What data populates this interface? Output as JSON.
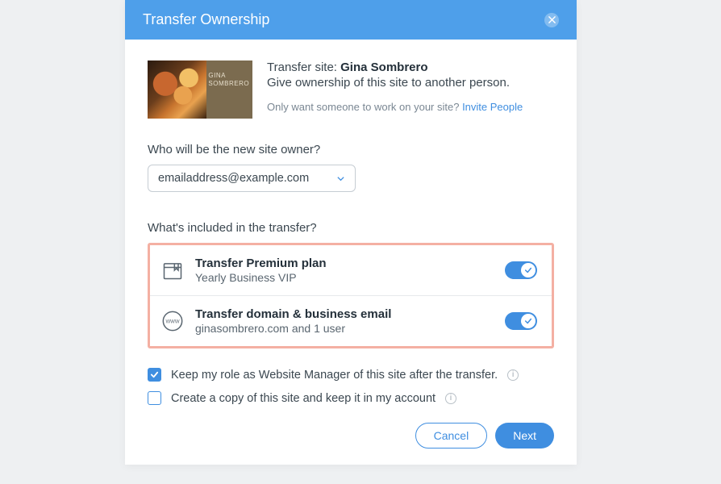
{
  "modal": {
    "title": "Transfer Ownership",
    "thumb_label_line1": "GINA",
    "thumb_label_line2": "SOMBRERO",
    "transfer_label": "Transfer site: ",
    "site_name": "Gina Sombrero",
    "subtitle": "Give ownership of this site to another person.",
    "invite_prompt": "Only want someone to work on your site? ",
    "invite_link": "Invite People",
    "owner_label": "Who will be the new site owner?",
    "owner_value": "emailaddress@example.com",
    "included_label": "What's included in the transfer?",
    "items": [
      {
        "title": "Transfer Premium plan",
        "sub": "Yearly Business VIP"
      },
      {
        "title": "Transfer domain & business email",
        "sub": "ginasombrero.com and 1 user"
      }
    ],
    "keep_role": "Keep my role as Website Manager of this site after the transfer.",
    "copy_site": "Create a copy of this site and keep it in my account",
    "cancel": "Cancel",
    "next": "Next"
  }
}
